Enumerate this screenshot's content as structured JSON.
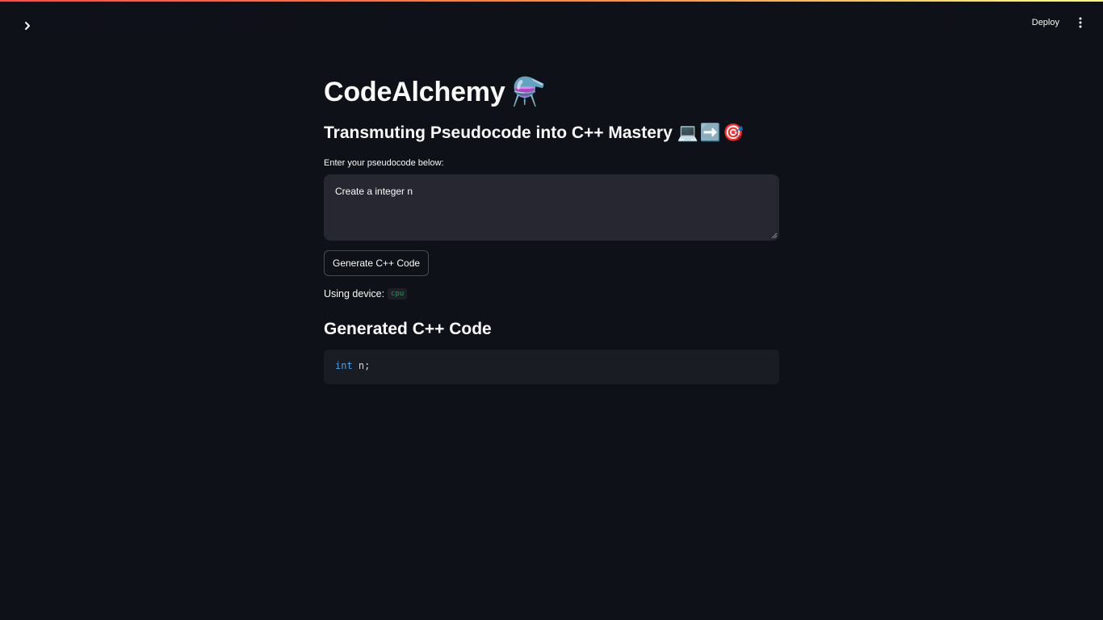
{
  "header": {
    "sidebar_toggle_icon": "chevron-right-icon",
    "deploy_label": "Deploy",
    "menu_icon": "more-vertical-icon"
  },
  "main": {
    "title": "CodeAlchemy",
    "title_emoji": "⚗️",
    "subtitle": "Transmuting Pseudocode into C++ Mastery",
    "subtitle_emojis": [
      "💻",
      "➡️",
      "🎯"
    ],
    "input_label": "Enter your pseudocode below:",
    "input_value": "Create a integer n",
    "generate_label": "Generate C++ Code",
    "device_prefix": "Using device:",
    "device_value": "cpu",
    "output_heading": "Generated C++ Code",
    "code": {
      "keyword": "int",
      "rest": " n;"
    }
  },
  "colors": {
    "background": "#0e1117",
    "input_bg": "#262730",
    "code_bg": "#1a1c24",
    "keyword": "#4f9ee8",
    "device_code": "#09ab3b",
    "top_gradient_start": "#ff4b4b",
    "top_gradient_end": "#fffd80"
  }
}
